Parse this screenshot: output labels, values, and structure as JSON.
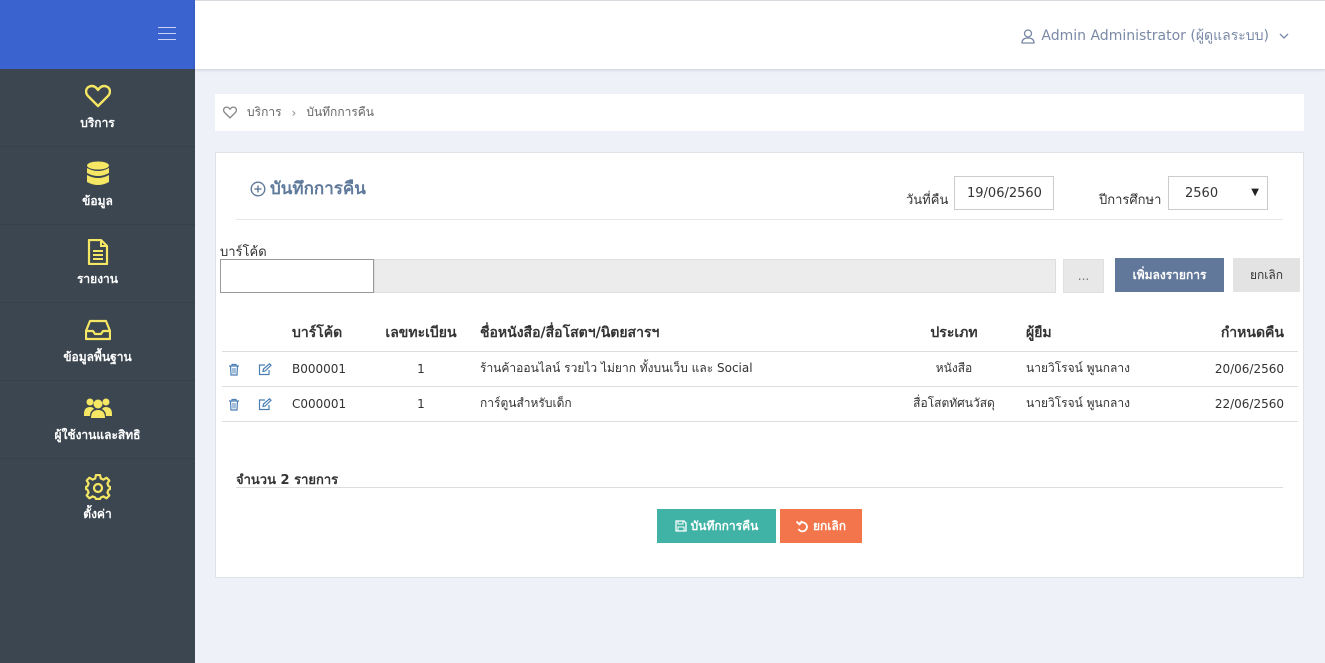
{
  "sidebar": {
    "items": [
      {
        "label": "บริการ",
        "icon": "heart-icon"
      },
      {
        "label": "ข้อมูล",
        "icon": "database-icon"
      },
      {
        "label": "รายงาน",
        "icon": "file-icon"
      },
      {
        "label": "ข้อมูลพื้นฐาน",
        "icon": "inbox-icon"
      },
      {
        "label": "ผู้ใช้งานและสิทธิ",
        "icon": "users-icon"
      },
      {
        "label": "ตั้งค่า",
        "icon": "gear-icon"
      }
    ]
  },
  "header": {
    "user": "Admin Administrator (ผู้ดูแลระบบ)"
  },
  "breadcrumb": {
    "home": "บริการ",
    "current": "บันทึกการคืน"
  },
  "form": {
    "title": "บันทึกการคืน",
    "date_label": "วันที่คืน",
    "date_value": "19/06/2560",
    "year_label": "ปีการศึกษา",
    "year_value": "2560",
    "barcode_label": "บาร์โค้ด",
    "dots_label": "...",
    "add_label": "เพิ่มลงรายการ",
    "cancel_top_label": "ยกเลิก"
  },
  "table": {
    "headers": {
      "barcode": "บาร์โค้ด",
      "reg_no": "เลขทะเบียน",
      "title": "ชื่อหนังสือ/สื่อโสตฯ/นิตยสารฯ",
      "type": "ประเภท",
      "borrower": "ผู้ยืม",
      "due": "กำหนดคืน"
    },
    "rows": [
      {
        "barcode": "B000001",
        "reg_no": "1",
        "title": "ร้านค้าออนไลน์ รวยไว ไม่ยาก ทั้งบนเว็บ และ Social",
        "type": "หนังสือ",
        "borrower": "นายวิโรจน์ พูนกลาง",
        "due": "20/06/2560"
      },
      {
        "barcode": "C000001",
        "reg_no": "1",
        "title": "การ์ตูนสำหรับเด็ก",
        "type": "สื่อโสตทัศนวัสดุ",
        "borrower": "นายวิโรจน์ พูนกลาง",
        "due": "22/06/2560"
      }
    ]
  },
  "summary": {
    "count": "จำนวน 2 รายการ"
  },
  "actions": {
    "save_label": "บันทึกการคืน",
    "cancel_label": "ยกเลิก"
  },
  "colors": {
    "sidebar_bg": "#3b4650",
    "sidebar_top": "#3a63d0",
    "icon_yellow": "#f5e663",
    "add_button": "#62789a",
    "save_button": "#40b3a6",
    "cancel_button": "#f2754b"
  }
}
